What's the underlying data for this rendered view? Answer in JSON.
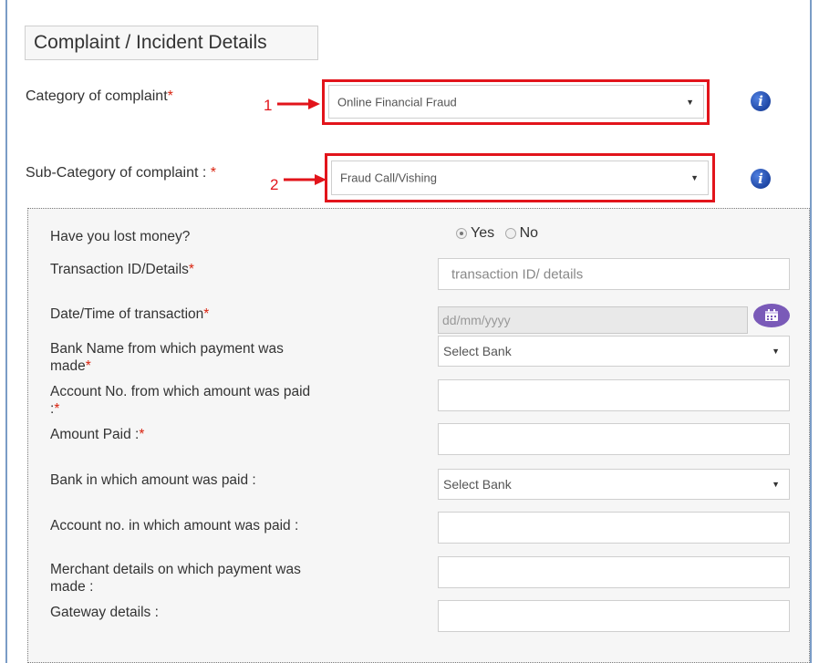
{
  "section_title": "Complaint / Incident Details",
  "category": {
    "label": "Category of complaint",
    "required_mark": "*",
    "selected": "Online Financial Fraud",
    "callout": "1"
  },
  "subcategory": {
    "label": "Sub-Category of complaint : ",
    "required_mark": "*",
    "selected": "Fraud Call/Vishing",
    "callout": "2"
  },
  "form": {
    "lost_money": {
      "label": "Have you lost money?",
      "yes": "Yes",
      "no": "No",
      "selected": "Yes"
    },
    "transaction_id": {
      "label": "Transaction ID/Details",
      "required_mark": "*",
      "placeholder": "transaction ID/ details"
    },
    "transaction_date": {
      "label": "Date/Time of transaction",
      "required_mark": "*",
      "placeholder": "dd/mm/yyyy"
    },
    "payer_bank": {
      "label_line1": "Bank Name from which payment was",
      "label_line2": "made",
      "required_mark": "*",
      "selected": "Select Bank"
    },
    "payer_account": {
      "label_line1": "Account No. from which amount was paid",
      "label_line2": ":",
      "required_mark": "*"
    },
    "amount_paid": {
      "label": "Amount Paid :",
      "required_mark": "*"
    },
    "payee_bank": {
      "label": "Bank in which amount was paid :",
      "selected": "Select Bank"
    },
    "payee_account": {
      "label": "Account no. in which amount was paid :"
    },
    "merchant": {
      "label_line1": "Merchant details on which payment was",
      "label_line2": "made :"
    },
    "gateway": {
      "label": "Gateway details :"
    }
  },
  "colors": {
    "highlight": "#e2141b",
    "required": "#d9230f",
    "info_icon": "#0b2f8a",
    "calendar_icon": "#7a5ab8"
  },
  "icons": [
    "info-icon",
    "calendar-icon",
    "dropdown-arrow-icon",
    "callout-arrow-icon"
  ]
}
